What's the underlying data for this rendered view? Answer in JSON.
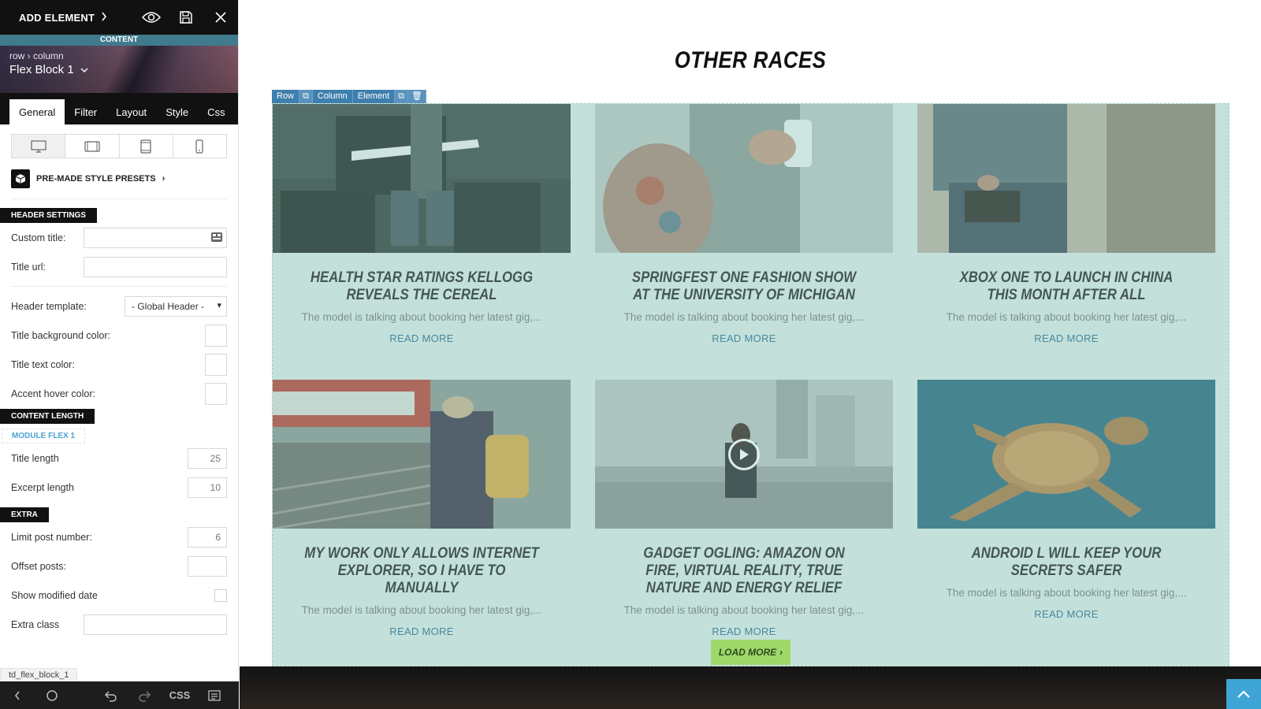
{
  "toolbar": {
    "add_element_label": "ADD ELEMENT",
    "content_label": "CONTENT"
  },
  "hero": {
    "breadcrumb": "row › column",
    "block_name": "Flex Block 1"
  },
  "tabs": [
    {
      "label": "General",
      "active": true
    },
    {
      "label": "Filter",
      "active": false
    },
    {
      "label": "Layout",
      "active": false
    },
    {
      "label": "Style",
      "active": false
    },
    {
      "label": "Css",
      "active": false
    }
  ],
  "devices": [
    "desktop-icon",
    "tablet-landscape-icon",
    "tablet-portrait-icon",
    "phone-icon"
  ],
  "presets_label": "PRE-MADE STYLE PRESETS",
  "header_settings": {
    "section_label": "HEADER SETTINGS",
    "custom_title_label": "Custom title:",
    "custom_title_value": "",
    "title_url_label": "Title url:",
    "title_url_value": "",
    "header_template_label": "Header template:",
    "header_template_value": "- Global Header -",
    "title_bg_color_label": "Title background color:",
    "title_text_color_label": "Title text color:",
    "accent_hover_color_label": "Accent hover color:"
  },
  "content_length": {
    "section_label": "CONTENT LENGTH",
    "module_label": "MODULE FLEX 1",
    "title_length_label": "Title length",
    "title_length_value": "25",
    "excerpt_length_label": "Excerpt length",
    "excerpt_length_value": "10"
  },
  "extra": {
    "section_label": "EXTRA",
    "limit_post_label": "Limit post number:",
    "limit_post_value": "6",
    "offset_posts_label": "Offset posts:",
    "offset_posts_value": "",
    "show_modified_label": "Show modified date",
    "show_modified_checked": false,
    "extra_class_label": "Extra class",
    "extra_class_value": ""
  },
  "class_tag": "td_flex_block_1",
  "bottom_bar": {
    "css_label": "CSS"
  },
  "main": {
    "section_title": "OTHER RACES",
    "builder_tags": {
      "row": "Row",
      "column": "Column",
      "element": "Element"
    },
    "read_more_label": "READ MORE",
    "load_more_label": "LOAD MORE",
    "posts": [
      {
        "title": "HEALTH STAR RATINGS KELLOGG REVEALS THE CEREAL",
        "excerpt": "The model is talking about booking her latest gig,...",
        "image": "guitarist-amplifier"
      },
      {
        "title": "SPRINGFEST ONE FASHION SHOW AT THE UNIVERSITY OF MICHIGAN",
        "excerpt": "The model is talking about booking her latest gig,...",
        "image": "tattooed-woman-mug"
      },
      {
        "title": "XBOX ONE TO LAUNCH IN CHINA THIS MONTH AFTER ALL",
        "excerpt": "The model is talking about booking her latest gig,...",
        "image": "man-sitting-wood"
      },
      {
        "title": "MY WORK ONLY ALLOWS INTERNET EXPLORER, SO I HAVE TO MANUALLY",
        "excerpt": "The model is talking about booking her latest gig,...",
        "image": "traveler-train-platform"
      },
      {
        "title": "GADGET OGLING: AMAZON ON FIRE, VIRTUAL REALITY, TRUE NATURE AND ENERGY RELIEF",
        "excerpt": "The model is talking about booking her latest gig,...",
        "image": "woman-city-video"
      },
      {
        "title": "ANDROID L WILL KEEP YOUR SECRETS SAFER",
        "excerpt": "The model is talking about booking her latest gig,...",
        "image": "sea-turtle"
      }
    ]
  }
}
